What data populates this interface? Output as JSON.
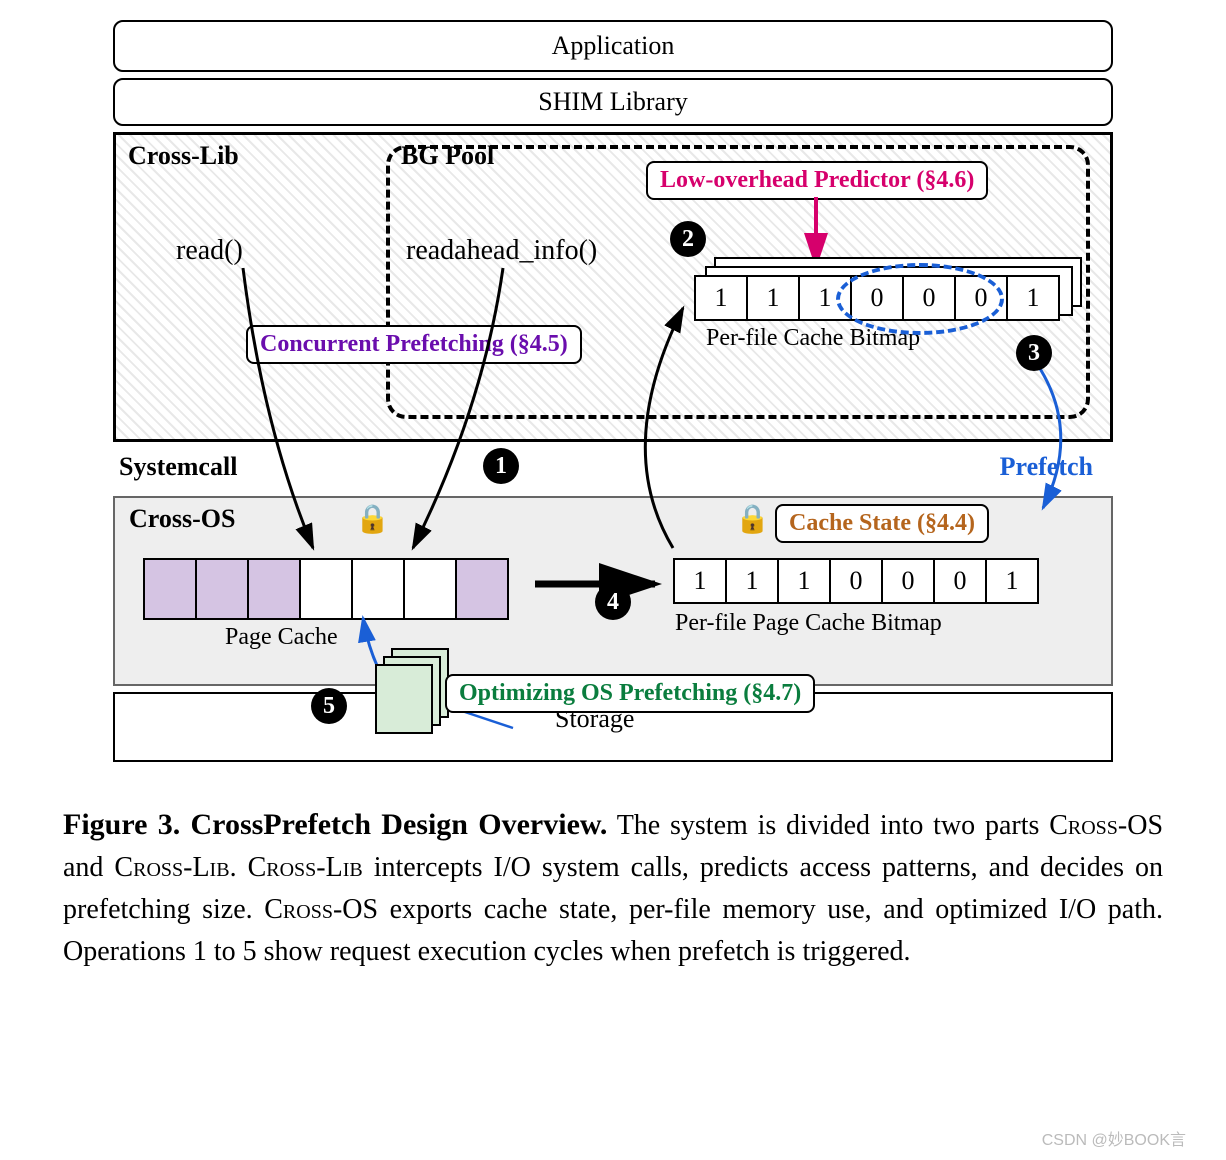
{
  "layers": {
    "application": "Application",
    "shim": "SHIM Library",
    "crosslib": "Cross-Lib",
    "bgpool": "BG Pool",
    "systemcall": "Systemcall",
    "crossos": "Cross-OS",
    "prefetch": "Prefetch",
    "storage": "Storage"
  },
  "calls": {
    "read": "read()",
    "readahead": "readahead_info()"
  },
  "chips": {
    "predictor": "Low-overhead Predictor (§4.6)",
    "concurrent": "Concurrent Prefetching (§4.5)",
    "cache_state": "Cache State (§4.4)",
    "optimize": "Optimizing OS Prefetching (§4.7)"
  },
  "bitmaps": {
    "perfile_cache_bitmap": {
      "label": "Per-file Cache Bitmap",
      "values": [
        "1",
        "1",
        "1",
        "0",
        "0",
        "0",
        "1"
      ]
    },
    "perfile_page_cache_bitmap": {
      "label": "Per-file Page Cache Bitmap",
      "values": [
        "1",
        "1",
        "1",
        "0",
        "0",
        "0",
        "1"
      ]
    }
  },
  "pagecache": {
    "label": "Page Cache",
    "filled_pattern": [
      true,
      true,
      true,
      false,
      false,
      false,
      true
    ]
  },
  "steps": {
    "n1": "1",
    "n2": "2",
    "n3": "3",
    "n4": "4",
    "n5": "5"
  },
  "caption": {
    "title": "Figure 3. CrossPrefetch Design Overview.",
    "body_1": " The system is divided into two parts ",
    "cross_os": "Cross-OS",
    "and": " and ",
    "cross_lib": "Cross-Lib",
    "body_2": ". ",
    "body_3": " intercepts I/O system calls, predicts access patterns, and decides on prefetching size. ",
    "body_4": " exports cache state, per-file memory use, and optimized I/O path. Operations 1 to 5 show request execution cycles when prefetch is triggered."
  },
  "watermark": "CSDN @妙BOOK言"
}
